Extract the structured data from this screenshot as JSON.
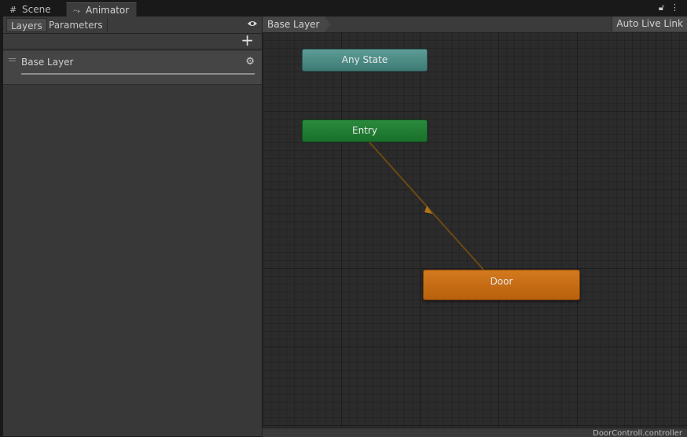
{
  "tabs": [
    {
      "label": "Scene",
      "icon": "grid-icon"
    },
    {
      "label": "Animator",
      "icon": "animator-icon",
      "active": true
    }
  ],
  "left_panel": {
    "tabs": [
      {
        "label": "Layers",
        "active": true
      },
      {
        "label": "Parameters"
      }
    ],
    "layers": [
      {
        "name": "Base Layer"
      }
    ]
  },
  "graph": {
    "breadcrumb": "Base Layer",
    "auto_live_link": "Auto Live Link",
    "states": {
      "any_state": "Any State",
      "entry": "Entry",
      "door": "Door"
    },
    "colors": {
      "any_state": "#4e8c86",
      "entry": "#22803a",
      "door": "#c86d16",
      "transition": "#6b4a12"
    }
  },
  "status": {
    "file": "DoorControll.controller"
  }
}
